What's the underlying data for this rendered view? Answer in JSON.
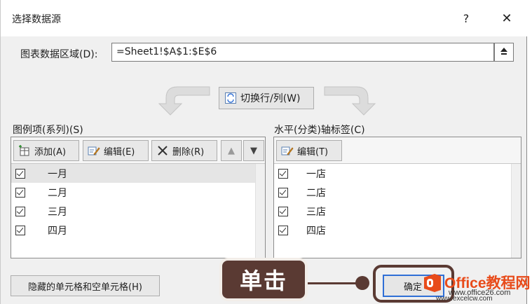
{
  "window": {
    "title": "选择数据源",
    "help": "?",
    "close": "✕"
  },
  "range": {
    "label": "图表数据区域(D):",
    "value": "=Sheet1!$A$1:$E$6",
    "collapse_icon": "collapse-up-icon"
  },
  "switch_button": {
    "label": "切换行/列(W)"
  },
  "legend": {
    "label": "图例项(系列)(S)",
    "add": "添加(A)",
    "edit": "编辑(E)",
    "remove": "删除(R)",
    "items": [
      {
        "label": "一月",
        "checked": true,
        "selected": true
      },
      {
        "label": "二月",
        "checked": true
      },
      {
        "label": "三月",
        "checked": true
      },
      {
        "label": "四月",
        "checked": true
      }
    ]
  },
  "axis": {
    "label": "水平(分类)轴标签(C)",
    "edit": "编辑(T)",
    "items": [
      {
        "label": "一店",
        "checked": true
      },
      {
        "label": "二店",
        "checked": true
      },
      {
        "label": "三店",
        "checked": true
      },
      {
        "label": "四店",
        "checked": true
      }
    ]
  },
  "footer": {
    "hidden_cells": "隐藏的单元格和空单元格(H)",
    "ok": "确定"
  },
  "annotation": {
    "callout": "单击"
  },
  "watermark": {
    "title": "Office教程网",
    "url": "www.office26.com",
    "bottom": "www.excelcw.com"
  },
  "colors": {
    "callout": "#5a3a33",
    "ok_border": "#2f6fd6",
    "watermark": "#e84b1a"
  }
}
